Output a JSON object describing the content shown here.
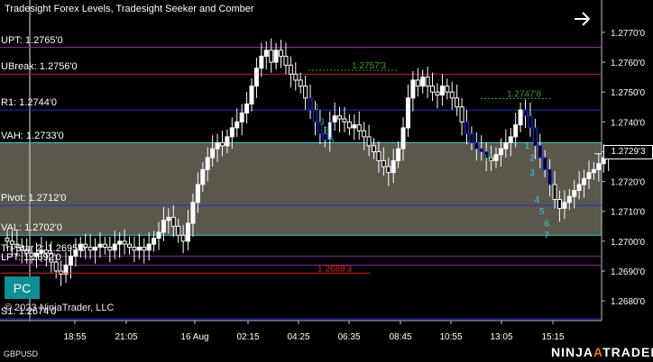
{
  "header": {
    "title": "Tradesight Forex Levels, Tradesight Seeker and Comber"
  },
  "buttons": {
    "pc_label": "PC"
  },
  "footer": {
    "copyright": "© 2023 NinjaTrader, LLC",
    "instrument": "GBPUSD",
    "brand_ninja": "NINJA",
    "brand_a": "A",
    "brand_trader": "TRADER"
  },
  "levels": [
    {
      "label": "UPT: 1.2765'0",
      "price": 1.2765,
      "color": "#9a1fb0"
    },
    {
      "label": "UBreak: 1.2756'0",
      "price": 1.2756,
      "color": "#c81e1e"
    },
    {
      "label": "R1: 1.2744'0",
      "price": 1.2744,
      "color": "#1f2ee0"
    },
    {
      "label": "VAH: 1.2733'0",
      "price": 1.2733,
      "color": "#2ad4d4"
    },
    {
      "label": "Pivot: 1.2712'0",
      "price": 1.2712,
      "color": "#1f2ee0"
    },
    {
      "label": "VAL: 1.2702'0",
      "price": 1.2702,
      "color": "#2ad4d4"
    },
    {
      "label": "Tri-Star 2: 1.2695'0",
      "price": 1.2695,
      "color": "#9a1fb0"
    },
    {
      "label": "LPT: 1.2692'0",
      "price": 1.2692,
      "color": "#9a1fb0"
    },
    {
      "label": "S1: 1.2674'0",
      "price": 1.2674,
      "color": "#1f2ee0"
    }
  ],
  "value_area": {
    "top": 1.2733,
    "bottom": 1.2702,
    "color": "#5b574c"
  },
  "current_price": {
    "label": "1.2729'3",
    "price": 1.27293
  },
  "annotations": [
    {
      "text": "1.2757'3",
      "price": 1.27573,
      "color": "#2ea02e"
    },
    {
      "text": "1.2747'8",
      "price": 1.27478,
      "color": "#2ea02e"
    },
    {
      "text": "1.2689'3",
      "price": 1.26893,
      "color": "#e02020"
    }
  ],
  "chart_data": {
    "type": "candlestick",
    "y_axis": {
      "ticks": [
        "1.2770'0",
        "1.2760'0",
        "1.2750'0",
        "1.2740'0",
        "1.2730'0",
        "1.2720'0",
        "1.2710'0",
        "1.2700'0",
        "1.2690'0",
        "1.2680'0"
      ],
      "tick_values": [
        1.277,
        1.276,
        1.275,
        1.274,
        1.273,
        1.272,
        1.271,
        1.27,
        1.269,
        1.268
      ],
      "ylim": [
        1.2673,
        1.2778
      ]
    },
    "x_axis": {
      "ticks": [
        "18:55",
        "21:05",
        "16 Aug",
        "02:15",
        "04:25",
        "06:35",
        "08:45",
        "10:55",
        "13:05",
        "15:15"
      ]
    },
    "closes": [
      1.27,
      1.2699,
      1.2698,
      1.2697,
      1.2696,
      1.2695,
      1.2696,
      1.2697,
      1.2696,
      1.2693,
      1.269,
      1.2689,
      1.2692,
      1.2695,
      1.2697,
      1.2699,
      1.2698,
      1.2697,
      1.2698,
      1.2699,
      1.2698,
      1.2697,
      1.2699,
      1.27,
      1.2699,
      1.2698,
      1.2697,
      1.2698,
      1.2697,
      1.2699,
      1.2701,
      1.2703,
      1.2707,
      1.2708,
      1.2705,
      1.2702,
      1.27,
      1.2706,
      1.2713,
      1.2719,
      1.2724,
      1.2728,
      1.2731,
      1.2733,
      1.2732,
      1.2735,
      1.2738,
      1.274,
      1.2743,
      1.2746,
      1.2752,
      1.2758,
      1.2762,
      1.2764,
      1.276,
      1.2764,
      1.2762,
      1.2759,
      1.2756,
      1.2754,
      1.2752,
      1.2748,
      1.2744,
      1.274,
      1.2736,
      1.2734,
      1.274,
      1.2742,
      1.2741,
      1.274,
      1.2738,
      1.2739,
      1.2737,
      1.2735,
      1.2732,
      1.273,
      1.2727,
      1.2725,
      1.2723,
      1.2727,
      1.2731,
      1.2738,
      1.2748,
      1.2754,
      1.2752,
      1.2755,
      1.2752,
      1.275,
      1.2749,
      1.2752,
      1.275,
      1.2748,
      1.2745,
      1.274,
      1.2736,
      1.2733,
      1.2731,
      1.273,
      1.2728,
      1.2727,
      1.2729,
      1.2731,
      1.2733,
      1.2735,
      1.2739,
      1.2744,
      1.2742,
      1.2738,
      1.2732,
      1.2728,
      1.2724,
      1.2719,
      1.2714,
      1.2711,
      1.2713,
      1.2715,
      1.2717,
      1.2719,
      1.2721,
      1.2723,
      1.2724,
      1.2726,
      1.2728,
      1.2729
    ]
  },
  "signal_labels": [
    {
      "text": "1",
      "color": "#2ea02e",
      "idx": 63,
      "price": 1.2744
    },
    {
      "text": "3",
      "color": "#2ea02e",
      "idx": 64,
      "price": 1.2739
    },
    {
      "text": "5",
      "color": "#2ea02e",
      "idx": 65,
      "price": 1.2736
    },
    {
      "text": "6",
      "color": "#2ea02e",
      "idx": 66,
      "price": 1.2733
    },
    {
      "text": "13",
      "color": "#2ea02e",
      "idx": 98,
      "price": 1.2727
    },
    {
      "text": "1",
      "color": "#2ad4d4",
      "idx": 106,
      "price": 1.2731
    },
    {
      "text": "2",
      "color": "#2ad4d4",
      "idx": 107,
      "price": 1.2727
    },
    {
      "text": "3",
      "color": "#2ad4d4",
      "idx": 107,
      "price": 1.2722
    },
    {
      "text": "4",
      "color": "#2ad4d4",
      "idx": 108,
      "price": 1.2713
    },
    {
      "text": "5",
      "color": "#2ad4d4",
      "idx": 109,
      "price": 1.2709
    },
    {
      "text": "6",
      "color": "#2ad4d4",
      "idx": 110,
      "price": 1.2705
    },
    {
      "text": "7",
      "color": "#2ad4d4",
      "idx": 110,
      "price": 1.2701
    }
  ]
}
